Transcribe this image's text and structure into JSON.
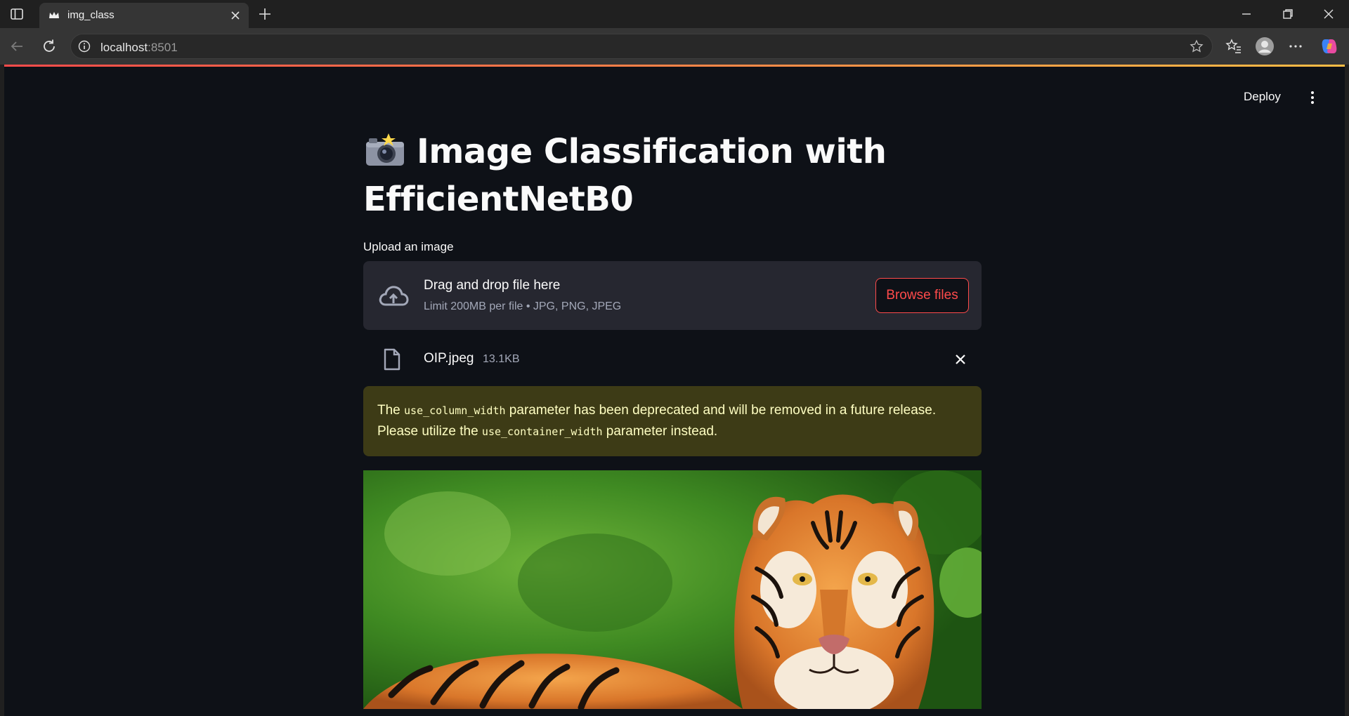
{
  "browser": {
    "tab_title": "img_class",
    "url_host": "localhost",
    "url_port": ":8501"
  },
  "header": {
    "deploy_label": "Deploy"
  },
  "main": {
    "title": "Image Classification with EfficientNetB0",
    "title_emoji_icon": "camera-flash-icon",
    "uploader": {
      "label": "Upload an image",
      "drop_title": "Drag and drop file here",
      "drop_subtitle": "Limit 200MB per file • JPG, PNG, JPEG",
      "browse_label": "Browse files"
    },
    "file": {
      "name": "OIP.jpeg",
      "size": "13.1KB"
    },
    "warning": {
      "part1": "The ",
      "code1": "use_column_width",
      "part2": " parameter has been deprecated and will be removed in a future release. Please utilize the ",
      "code2": "use_container_width",
      "part3": " parameter instead."
    }
  },
  "colors": {
    "app_bg": "#0e1117",
    "accent": "#ff4b4b",
    "dropzone_bg": "#262730",
    "warning_bg": "#3d3b16",
    "warning_text": "#ffffc2"
  }
}
